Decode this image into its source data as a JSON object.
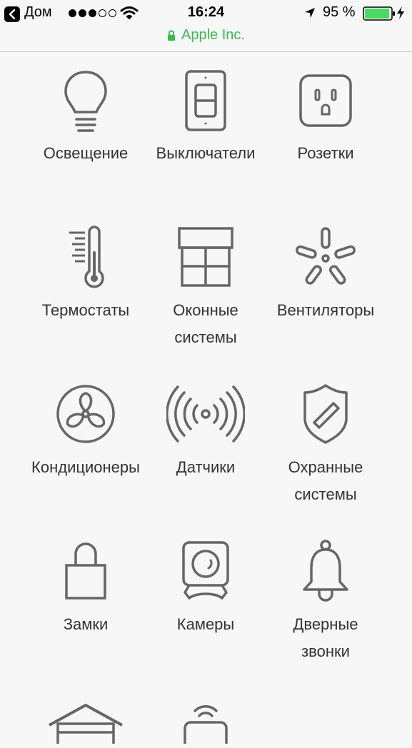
{
  "status_bar": {
    "back_app": "Дом",
    "time": "16:24",
    "battery_percent": "95 %",
    "signal_bars_filled": 3,
    "signal_bars_total": 5,
    "battery_color": "#4cd964",
    "icons": [
      "back-arrow-icon",
      "wifi-icon",
      "location-arrow-icon",
      "battery-icon",
      "charging-bolt-icon"
    ]
  },
  "address_bar": {
    "site": "Apple Inc.",
    "color": "#3cb950",
    "icon": "lock-icon"
  },
  "categories": [
    {
      "label": "Освещение",
      "icon": "lightbulb-icon"
    },
    {
      "label": "Выключатели",
      "icon": "switch-icon"
    },
    {
      "label": "Розетки",
      "icon": "outlet-icon"
    },
    {
      "label": "Термостаты",
      "icon": "thermostat-icon"
    },
    {
      "label": "Оконные\nсистемы",
      "icon": "window-icon"
    },
    {
      "label": "Вентиляторы",
      "icon": "ceiling-fan-icon"
    },
    {
      "label": "Кондиционеры",
      "icon": "air-conditioner-icon"
    },
    {
      "label": "Датчики",
      "icon": "sensor-icon"
    },
    {
      "label": "Охранные\nсистемы",
      "icon": "security-shield-icon"
    },
    {
      "label": "Замки",
      "icon": "lock-icon"
    },
    {
      "label": "Камеры",
      "icon": "camera-icon"
    },
    {
      "label": "Дверные\nзвонки",
      "icon": "doorbell-icon"
    },
    {
      "label": "",
      "icon": "garage-icon"
    },
    {
      "label": "",
      "icon": "router-icon"
    }
  ]
}
